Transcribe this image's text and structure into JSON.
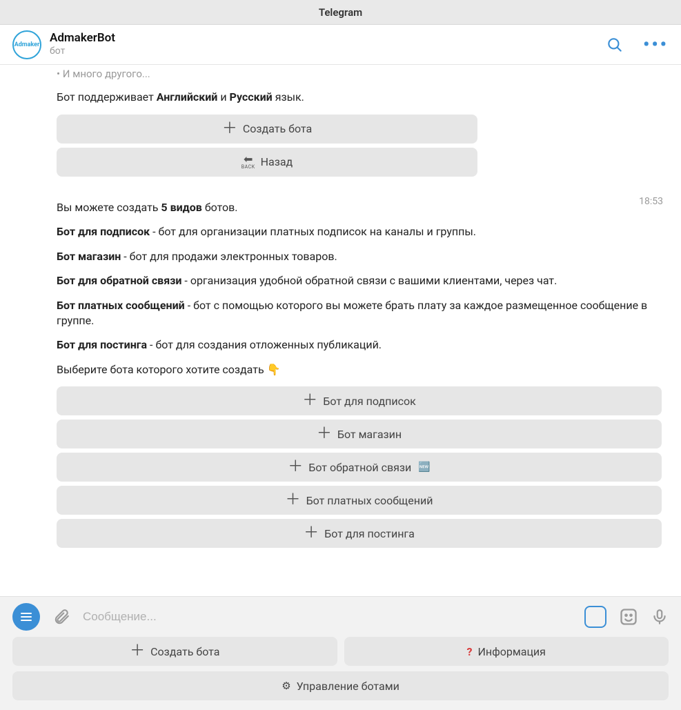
{
  "titlebar": {
    "app_name": "Telegram"
  },
  "header": {
    "avatar_label": "Admaker",
    "name": "AdmakerBot",
    "subtitle": "бот"
  },
  "message1": {
    "cutoff_line": "• И много другого...",
    "lang_prefix": "Бот поддерживает ",
    "lang_bold1": "Английский",
    "lang_mid": " и ",
    "lang_bold2": "Русский",
    "lang_suffix": " язык.",
    "kb": [
      {
        "label": "Создать бота",
        "icon": "plus"
      },
      {
        "label": "Назад",
        "icon": "back"
      }
    ]
  },
  "message2": {
    "timestamp": "18:53",
    "intro_prefix": "Вы можете создать ",
    "intro_bold": "5 видов",
    "intro_suffix": " ботов.",
    "types": [
      {
        "name": "Бот для подписок",
        "desc": " - бот для организации платных подписок на каналы и группы."
      },
      {
        "name": "Бот магазин",
        "desc": " - бот для продажи электронных товаров."
      },
      {
        "name": "Бот для обратной связи",
        "desc": " - организация удобной обратной связи с вашими клиентами, через чат."
      },
      {
        "name": "Бот платных сообщений",
        "desc": " - бот с помощью которого вы можете брать плату за каждое размещенное сообщение в группе."
      },
      {
        "name": "Бот для постинга",
        "desc": " - бот для создания отложенных публикаций."
      }
    ],
    "choose_text": "Выберите бота которого хотите создать 👇",
    "kb": [
      {
        "label": "Бот для подписок",
        "new": false
      },
      {
        "label": "Бот магазин",
        "new": false
      },
      {
        "label": "Бот обратной связи",
        "new": true
      },
      {
        "label": "Бот платных сообщений",
        "new": false
      },
      {
        "label": "Бот для постинга",
        "new": false
      }
    ]
  },
  "input": {
    "placeholder": "Сообщение..."
  },
  "reply_kb": {
    "row1": [
      {
        "label": "Создать бота",
        "icon": "plus"
      },
      {
        "label": "Информация",
        "icon": "qmark"
      }
    ],
    "row2": [
      {
        "label": "Управление ботами",
        "icon": "gear"
      }
    ]
  },
  "icons": {
    "new_badge": "🆕"
  }
}
